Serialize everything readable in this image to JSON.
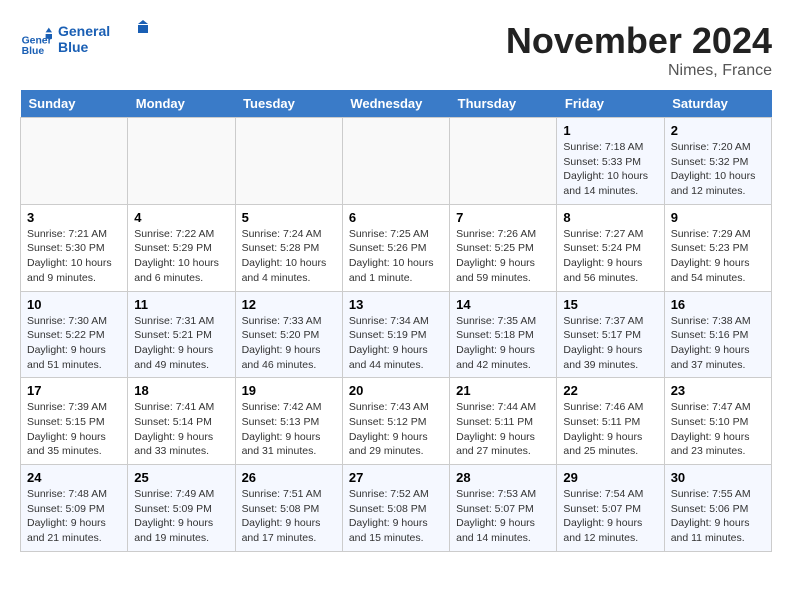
{
  "header": {
    "logo_line1": "General",
    "logo_line2": "Blue",
    "month": "November 2024",
    "location": "Nimes, France"
  },
  "weekdays": [
    "Sunday",
    "Monday",
    "Tuesday",
    "Wednesday",
    "Thursday",
    "Friday",
    "Saturday"
  ],
  "weeks": [
    [
      {
        "day": "",
        "sunrise": "",
        "sunset": "",
        "daylight": ""
      },
      {
        "day": "",
        "sunrise": "",
        "sunset": "",
        "daylight": ""
      },
      {
        "day": "",
        "sunrise": "",
        "sunset": "",
        "daylight": ""
      },
      {
        "day": "",
        "sunrise": "",
        "sunset": "",
        "daylight": ""
      },
      {
        "day": "",
        "sunrise": "",
        "sunset": "",
        "daylight": ""
      },
      {
        "day": "1",
        "sunrise": "Sunrise: 7:18 AM",
        "sunset": "Sunset: 5:33 PM",
        "daylight": "Daylight: 10 hours and 14 minutes."
      },
      {
        "day": "2",
        "sunrise": "Sunrise: 7:20 AM",
        "sunset": "Sunset: 5:32 PM",
        "daylight": "Daylight: 10 hours and 12 minutes."
      }
    ],
    [
      {
        "day": "3",
        "sunrise": "Sunrise: 7:21 AM",
        "sunset": "Sunset: 5:30 PM",
        "daylight": "Daylight: 10 hours and 9 minutes."
      },
      {
        "day": "4",
        "sunrise": "Sunrise: 7:22 AM",
        "sunset": "Sunset: 5:29 PM",
        "daylight": "Daylight: 10 hours and 6 minutes."
      },
      {
        "day": "5",
        "sunrise": "Sunrise: 7:24 AM",
        "sunset": "Sunset: 5:28 PM",
        "daylight": "Daylight: 10 hours and 4 minutes."
      },
      {
        "day": "6",
        "sunrise": "Sunrise: 7:25 AM",
        "sunset": "Sunset: 5:26 PM",
        "daylight": "Daylight: 10 hours and 1 minute."
      },
      {
        "day": "7",
        "sunrise": "Sunrise: 7:26 AM",
        "sunset": "Sunset: 5:25 PM",
        "daylight": "Daylight: 9 hours and 59 minutes."
      },
      {
        "day": "8",
        "sunrise": "Sunrise: 7:27 AM",
        "sunset": "Sunset: 5:24 PM",
        "daylight": "Daylight: 9 hours and 56 minutes."
      },
      {
        "day": "9",
        "sunrise": "Sunrise: 7:29 AM",
        "sunset": "Sunset: 5:23 PM",
        "daylight": "Daylight: 9 hours and 54 minutes."
      }
    ],
    [
      {
        "day": "10",
        "sunrise": "Sunrise: 7:30 AM",
        "sunset": "Sunset: 5:22 PM",
        "daylight": "Daylight: 9 hours and 51 minutes."
      },
      {
        "day": "11",
        "sunrise": "Sunrise: 7:31 AM",
        "sunset": "Sunset: 5:21 PM",
        "daylight": "Daylight: 9 hours and 49 minutes."
      },
      {
        "day": "12",
        "sunrise": "Sunrise: 7:33 AM",
        "sunset": "Sunset: 5:20 PM",
        "daylight": "Daylight: 9 hours and 46 minutes."
      },
      {
        "day": "13",
        "sunrise": "Sunrise: 7:34 AM",
        "sunset": "Sunset: 5:19 PM",
        "daylight": "Daylight: 9 hours and 44 minutes."
      },
      {
        "day": "14",
        "sunrise": "Sunrise: 7:35 AM",
        "sunset": "Sunset: 5:18 PM",
        "daylight": "Daylight: 9 hours and 42 minutes."
      },
      {
        "day": "15",
        "sunrise": "Sunrise: 7:37 AM",
        "sunset": "Sunset: 5:17 PM",
        "daylight": "Daylight: 9 hours and 39 minutes."
      },
      {
        "day": "16",
        "sunrise": "Sunrise: 7:38 AM",
        "sunset": "Sunset: 5:16 PM",
        "daylight": "Daylight: 9 hours and 37 minutes."
      }
    ],
    [
      {
        "day": "17",
        "sunrise": "Sunrise: 7:39 AM",
        "sunset": "Sunset: 5:15 PM",
        "daylight": "Daylight: 9 hours and 35 minutes."
      },
      {
        "day": "18",
        "sunrise": "Sunrise: 7:41 AM",
        "sunset": "Sunset: 5:14 PM",
        "daylight": "Daylight: 9 hours and 33 minutes."
      },
      {
        "day": "19",
        "sunrise": "Sunrise: 7:42 AM",
        "sunset": "Sunset: 5:13 PM",
        "daylight": "Daylight: 9 hours and 31 minutes."
      },
      {
        "day": "20",
        "sunrise": "Sunrise: 7:43 AM",
        "sunset": "Sunset: 5:12 PM",
        "daylight": "Daylight: 9 hours and 29 minutes."
      },
      {
        "day": "21",
        "sunrise": "Sunrise: 7:44 AM",
        "sunset": "Sunset: 5:11 PM",
        "daylight": "Daylight: 9 hours and 27 minutes."
      },
      {
        "day": "22",
        "sunrise": "Sunrise: 7:46 AM",
        "sunset": "Sunset: 5:11 PM",
        "daylight": "Daylight: 9 hours and 25 minutes."
      },
      {
        "day": "23",
        "sunrise": "Sunrise: 7:47 AM",
        "sunset": "Sunset: 5:10 PM",
        "daylight": "Daylight: 9 hours and 23 minutes."
      }
    ],
    [
      {
        "day": "24",
        "sunrise": "Sunrise: 7:48 AM",
        "sunset": "Sunset: 5:09 PM",
        "daylight": "Daylight: 9 hours and 21 minutes."
      },
      {
        "day": "25",
        "sunrise": "Sunrise: 7:49 AM",
        "sunset": "Sunset: 5:09 PM",
        "daylight": "Daylight: 9 hours and 19 minutes."
      },
      {
        "day": "26",
        "sunrise": "Sunrise: 7:51 AM",
        "sunset": "Sunset: 5:08 PM",
        "daylight": "Daylight: 9 hours and 17 minutes."
      },
      {
        "day": "27",
        "sunrise": "Sunrise: 7:52 AM",
        "sunset": "Sunset: 5:08 PM",
        "daylight": "Daylight: 9 hours and 15 minutes."
      },
      {
        "day": "28",
        "sunrise": "Sunrise: 7:53 AM",
        "sunset": "Sunset: 5:07 PM",
        "daylight": "Daylight: 9 hours and 14 minutes."
      },
      {
        "day": "29",
        "sunrise": "Sunrise: 7:54 AM",
        "sunset": "Sunset: 5:07 PM",
        "daylight": "Daylight: 9 hours and 12 minutes."
      },
      {
        "day": "30",
        "sunrise": "Sunrise: 7:55 AM",
        "sunset": "Sunset: 5:06 PM",
        "daylight": "Daylight: 9 hours and 11 minutes."
      }
    ]
  ]
}
